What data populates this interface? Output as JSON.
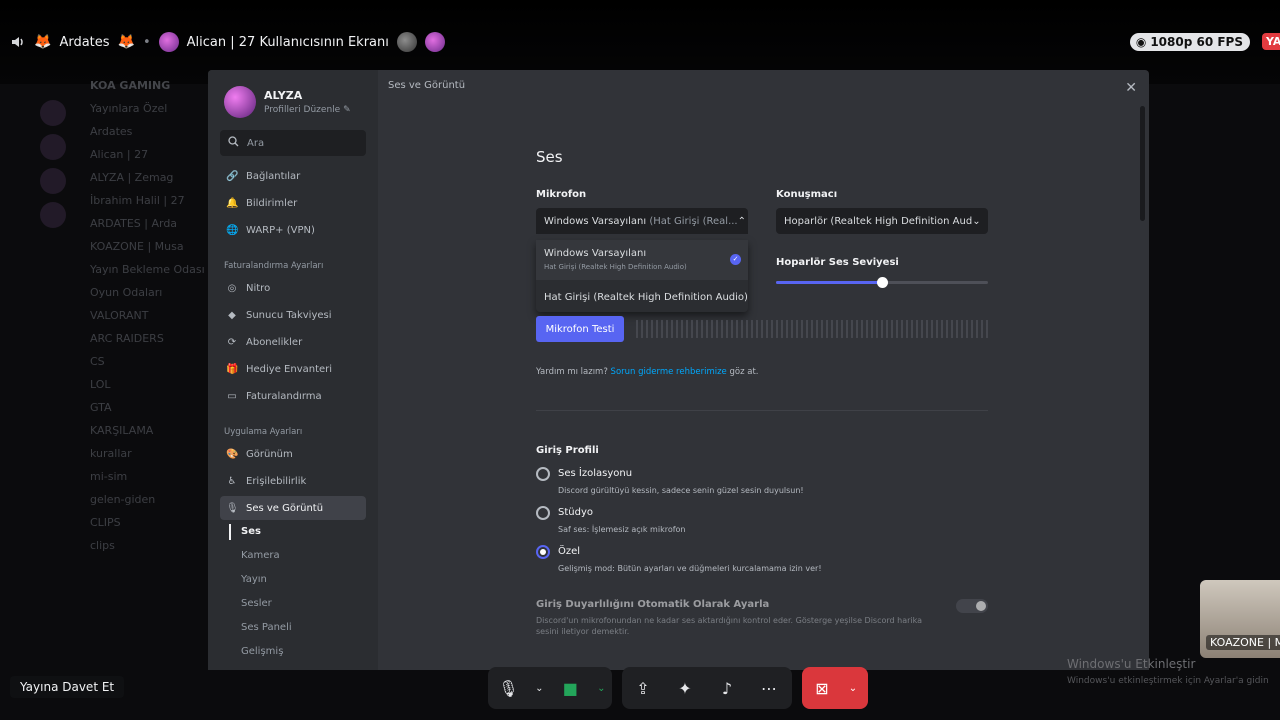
{
  "topbar": {
    "channel_a": "Ardates",
    "screen_title": "Alican | 27 Kullanıcısının Ekranı",
    "quality": "1080p 60 FPS",
    "live": "YA"
  },
  "background": {
    "server_name": "KOA GAMING",
    "rows": [
      "Yayınlara Özel",
      "Ardates",
      "Alican | 27",
      "ALYZA | Zemag",
      "İbrahim Halil | 27",
      "ARDATES | Arda",
      "KOAZONE | Musa",
      "Yayın Bekleme Odası",
      "Oyun Odaları",
      "VALORANT",
      "ARC RAIDERS",
      "CS",
      "LOL",
      "GTA",
      "KARŞILAMA",
      "kurallar",
      "mi-sim",
      "gelen-giden",
      "CLIPS",
      "clips"
    ]
  },
  "sidebar": {
    "username": "ALYZA",
    "edit_profile": "Profilleri Düzenle",
    "search_placeholder": "Ara",
    "items_top": [
      {
        "label": "Bağlantılar",
        "icon": "link-icon"
      },
      {
        "label": "Bildirimler",
        "icon": "bell-icon"
      },
      {
        "label": "WARP+ (VPN)",
        "icon": "globe-icon"
      }
    ],
    "billing_header": "Faturalandırma Ayarları",
    "items_billing": [
      {
        "label": "Nitro"
      },
      {
        "label": "Sunucu Takviyesi"
      },
      {
        "label": "Abonelikler"
      },
      {
        "label": "Hediye Envanteri"
      },
      {
        "label": "Faturalandırma"
      }
    ],
    "app_header": "Uygulama Ayarları",
    "items_app": [
      {
        "label": "Görünüm"
      },
      {
        "label": "Erişilebilirlik"
      },
      {
        "label": "Ses ve Görüntü"
      }
    ],
    "sub_items": [
      "Ses",
      "Kamera",
      "Yayın",
      "Sesler",
      "Ses Paneli",
      "Gelişmiş"
    ]
  },
  "content": {
    "title": "Ses ve Görüntü",
    "heading": "Ses",
    "mic_label": "Mikrofon",
    "mic_value": "Windows Varsayılanı",
    "mic_value_muted": "(Hat Girişi (Real...",
    "speaker_label": "Konuşmacı",
    "speaker_value": "Hoparlör (Realtek High Definition Aud",
    "dropdown_opt1": "Windows Varsayılanı",
    "dropdown_opt1_sub": "Hat Girişi (Realtek High Definition Audio)",
    "dropdown_opt2": "Hat Girişi (Realtek High Definition Audio)",
    "speaker_volume_label": "Hoparlör Ses Seviyesi",
    "speaker_volume": 0.5,
    "mic_test": "Mikrofon Testi",
    "help_text": "Yardım mı lazım?",
    "help_link": "Sorun giderme rehberimize",
    "help_suffix": "göz at.",
    "profile_label": "Giriş Profili",
    "profiles": [
      {
        "title": "Ses İzolasyonu",
        "desc": "Discord gürültüyü kessin, sadece senin güzel sesin duyulsun!",
        "selected": false
      },
      {
        "title": "Stüdyo",
        "desc": "Saf ses: İşlemesiz açık mikrofon",
        "selected": false
      },
      {
        "title": "Özel",
        "desc": "Gelişmiş mod: Bütün ayarları ve düğmeleri kurcalamama izin ver!",
        "selected": true
      }
    ],
    "sensitivity_label": "Giriş Duyarlılığını Otomatik Olarak Ayarla",
    "sensitivity_desc": "Discord'un mikrofonundan ne kadar ses aktardığını kontrol eder. Gösterge yeşilse Discord harika",
    "sensitivity_desc2": "sesini iletiyor demektir."
  },
  "bottom": {
    "invite": "Yayına Davet Et",
    "webcam_label": "KOAZONE | M",
    "win_activate": "Windows'u Etkinleştir",
    "win_activate_sub": "Windows'u etkinleştirmek için Ayarlar'a gidin"
  },
  "colors": {
    "accent": "#5865f2",
    "danger": "#da373c",
    "link": "#00a8fc"
  }
}
